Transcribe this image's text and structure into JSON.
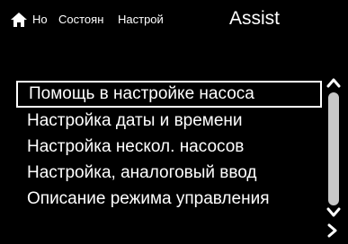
{
  "header": {
    "tabs": [
      {
        "label": "Но"
      },
      {
        "label": "Состоян"
      },
      {
        "label": "Настрой"
      }
    ],
    "title": "Assist"
  },
  "menu": {
    "items": [
      {
        "label": "Помощь в настройке насоса",
        "selected": true
      },
      {
        "label": "Настройка даты и времени",
        "selected": false
      },
      {
        "label": "Настройка нескол. насосов",
        "selected": false
      },
      {
        "label": "Настройка, аналоговый ввод",
        "selected": false
      },
      {
        "label": "Описание режима управления",
        "selected": false
      }
    ]
  },
  "icons": {
    "home": "home-icon",
    "scroll_up": "chevron-up-icon",
    "scroll_down": "chevron-down-icon",
    "next": "chevron-right-icon"
  },
  "colors": {
    "background": "#000000",
    "text": "#ffffff",
    "scrollbar": "#c8c8c8"
  }
}
